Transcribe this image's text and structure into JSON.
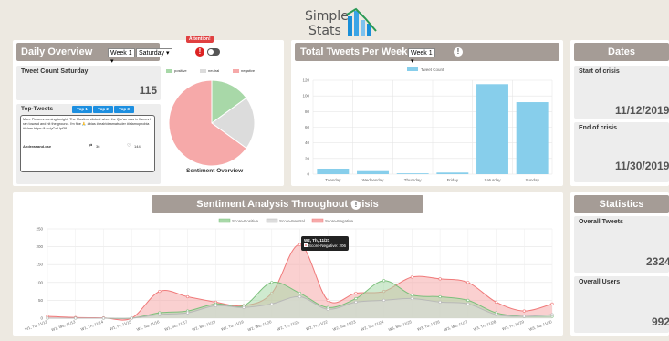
{
  "logo": {
    "line1": "Simple",
    "line2": "Stats"
  },
  "daily": {
    "title": "Daily Overview",
    "week_select": "Week 1",
    "day_select": "Saturday",
    "attention_label": "Attention!",
    "count_label": "Tweet Count Saturday",
    "count_value": "115",
    "top_tweets_label": "Top-Tweets",
    "tabs": [
      "Top 1",
      "Top 2",
      "Top 3"
    ],
    "tweet_text": "More Pictures coming tonight. The Muslims clicked when the Qur'an was in flames I ran toward and hit the ground. I'm fine 🙏 #bias #realrideamatrader #islamophobia #islam https://t.co/yCxiUpt38",
    "tweet_author": "Andreasand.ose",
    "retweets": "36",
    "likes": "144",
    "legend": [
      "positive",
      "neutral",
      "negative"
    ],
    "pie_title": "Sentiment Overview"
  },
  "weekly": {
    "title": "Total Tweets Per Week",
    "week_select": "Week 1",
    "legend_label": "Tweet Count"
  },
  "dates": {
    "title": "Dates",
    "start_label": "Start of crisis",
    "start_value": "11/12/2019",
    "end_label": "End of crisis",
    "end_value": "11/30/2019"
  },
  "sentiment": {
    "title": "Sentiment Analysis Throughout Crisis",
    "legend": [
      "Score-Positive",
      "Score-Neutral",
      "Score-Negative"
    ],
    "tooltip_title": "W2, Th, 11/21",
    "tooltip_value": "Score-Negative: 206"
  },
  "stats": {
    "title": "Statistics",
    "tweets_label": "Overall Tweets",
    "tweets_value": "2324",
    "users_label": "Overall Users",
    "users_value": "992"
  },
  "colors": {
    "positive": "#a8d8a8",
    "neutral": "#dcdcdc",
    "negative": "#f6a9a9",
    "bar": "#87ceeb",
    "header": "#a59c96"
  },
  "chart_data": [
    {
      "type": "pie",
      "title": "Sentiment Overview",
      "categories": [
        "positive",
        "neutral",
        "negative"
      ],
      "values": [
        15,
        20,
        65
      ]
    },
    {
      "type": "bar",
      "categories": [
        "Tuesday",
        "Wednesday",
        "Thursday",
        "Friday",
        "Saturday",
        "Sunday"
      ],
      "series": [
        {
          "name": "Tweet Count",
          "values": [
            7,
            5,
            1,
            2,
            115,
            92
          ]
        }
      ],
      "ylim": [
        0,
        120
      ],
      "yticks": [
        0,
        20,
        40,
        60,
        80,
        100,
        120
      ],
      "legend": "top-center",
      "grid": true
    },
    {
      "type": "area",
      "title": "Sentiment Analysis Throughout Crisis",
      "x": [
        "W1, Tu, 11/12",
        "W1, We, 11/13",
        "W1, Th, 11/14",
        "W1, Fr, 11/15",
        "W1, Sa, 11/16",
        "W1, Su, 11/17",
        "W2, Mo, 11/18",
        "W2, Tu, 11/19",
        "W2, We, 11/20",
        "W2, Th, 11/21",
        "W2, Fr, 11/22",
        "W2, Sa, 11/23",
        "W2, Su, 11/24",
        "W3, Mo, 11/25",
        "W3, Tu, 11/26",
        "W3, We, 11/27",
        "W3, Th, 11/28",
        "W3, Fr, 11/29",
        "W3, Sa, 11/30"
      ],
      "series": [
        {
          "name": "Score-Positive",
          "values": [
            0,
            0,
            0,
            0,
            15,
            20,
            40,
            35,
            100,
            70,
            30,
            55,
            105,
            65,
            60,
            50,
            15,
            5,
            5
          ]
        },
        {
          "name": "Score-Neutral",
          "values": [
            0,
            0,
            0,
            0,
            10,
            15,
            35,
            30,
            40,
            60,
            25,
            45,
            50,
            55,
            45,
            40,
            10,
            5,
            10
          ]
        },
        {
          "name": "Score-Negative",
          "values": [
            5,
            2,
            1,
            0,
            75,
            60,
            45,
            35,
            70,
            206,
            50,
            70,
            75,
            115,
            110,
            100,
            45,
            20,
            40
          ]
        }
      ],
      "ylim": [
        0,
        250
      ],
      "yticks": [
        0,
        50,
        100,
        150,
        200,
        250
      ],
      "legend": "top-center",
      "grid": true
    }
  ]
}
